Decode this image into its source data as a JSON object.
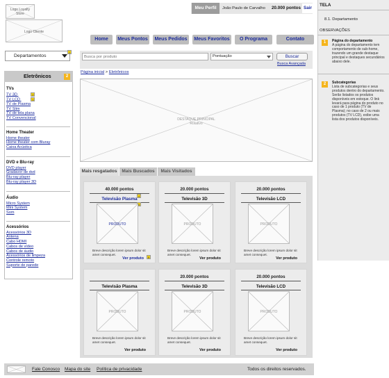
{
  "header": {
    "logo_loyalty": "Logo Loyalty Store",
    "logo_client": "Logo Cliente",
    "profile_label": "Meu Perfil",
    "user_name": "João Paulo de Carvalho",
    "points": "20.000 pontos",
    "logout_label": "Sair"
  },
  "nav": {
    "items": [
      "Home",
      "Meus Pontos",
      "Meus Pedidos",
      "Meus Favoritos",
      "O Programa",
      "Contato"
    ]
  },
  "search": {
    "department_select": "Departamentos",
    "department_badge": "1",
    "placeholder": "Busca por produto",
    "sort_select": "Pontuação",
    "button_label": "Buscar",
    "advanced_link": "Busca Avançada"
  },
  "breadcrumb": {
    "home": "Página inicial",
    "separator": ">",
    "current": "Eletrônicos"
  },
  "sidebar": {
    "title": "Eletrônicos",
    "title_badge": "2",
    "groups": [
      {
        "heading": "TVs",
        "items": [
          "TV 3D",
          "TV LCD",
          "TV de Plasma",
          "TV Slim",
          "TV de tela plana",
          "TV Convencional"
        ],
        "badges": {
          "0": "2",
          "1": "1"
        }
      },
      {
        "heading": "Home Theater",
        "items": [
          "Home theater",
          "Home theater com Bluray",
          "Caixa Acústica"
        ]
      },
      {
        "heading": "DVD e Blu-ray",
        "items": [
          "DVD player",
          "Gradavor de dvd",
          "Blu-ray player",
          "Blu-ray player 3D"
        ]
      },
      {
        "heading": "Áudio",
        "items": [
          "Micro System",
          "Mini System",
          "Som"
        ]
      },
      {
        "heading": "Acessórios",
        "items": [
          "Acessórios 3D",
          "Antena",
          "Cabo HDMI",
          "Cabos de vídeo",
          "Cabos de áudio",
          "Acessórios de limpeza",
          "Controle remoto",
          "Suporte de parede"
        ]
      }
    ]
  },
  "banner": {
    "caption_line1": "DESTAQUE PRINCIPAL",
    "caption_line2": "Rotativo"
  },
  "tabs": [
    "Mais resgatados",
    "Mais Buscados",
    "Mais Visitados"
  ],
  "products": [
    {
      "points": "40.000 pontos",
      "title": "Televisão Plasma",
      "image": "PRODUTO",
      "desc": "Breve descrição lorem ipsum dolor sit amet consequet.",
      "link": "Ver produto",
      "badge_title": "4",
      "badge_img": "5",
      "badge_link": "6"
    },
    {
      "points": "20.000 pontos",
      "title": "Televisão 3D",
      "image": "PRODUTO",
      "desc": "Breve descrição lorem ipsum dolor sit amet consequet.",
      "link": "Ver produto"
    },
    {
      "points": "20.000 pontos",
      "title": "Televisão LCD",
      "image": "PRODUTO",
      "desc": "Breve descrição lorem ipsum dolor sit amet consequet.",
      "link": "Ver produto"
    },
    {
      "points": "",
      "title": "Televisão Plasma",
      "image": "PRODUTO",
      "desc": "Breve descrição lorem ipsum dolor sit amet consequet.",
      "link": "Ver produto"
    },
    {
      "points": "20.000 pontos",
      "title": "Televisão 3D",
      "image": "PRODUTO",
      "desc": "Breve descrição lorem ipsum dolor sit amet consequet.",
      "link": "Ver produto"
    },
    {
      "points": "20.000 pontos",
      "title": "Televisão LCD",
      "image": "PRODUTO",
      "desc": "Breve descrição lorem ipsum dolor sit amet consequet.",
      "link": "Ver produto"
    }
  ],
  "footer": {
    "links": [
      "Fale Conosco",
      "Mapa do site",
      "Política de privacidade"
    ],
    "rights": "Todos os direitos reservados."
  },
  "annotations": {
    "tela_label": "TELA",
    "screen_name": "8.1. Departamento",
    "obs_label": "OBSERVAÇÕES",
    "notes": [
      {
        "num": "1",
        "title": "Página do departamento",
        "text": "A página do departamento tem comportamento de sub-home, trazendo um grande destaque principal e destaques secundários abaixo dele."
      },
      {
        "num": "2",
        "title": "Subcategorias",
        "text": "Lista de subcategorias e seus produtos dentro do departamento. Serão listados os produtos disponíveis em estoque. O link levará para página do produto no caso de 1 produto (TV de Plasma); no caso de 2 ou mais produtos (TV LCD), exibe uma lista dos produtos disponíveis."
      }
    ]
  },
  "colors": {
    "link": "#1a2a9c",
    "badge": "#f5d515",
    "note_badge": "#f5b51d",
    "nav_bg": "#bdbdbd"
  }
}
